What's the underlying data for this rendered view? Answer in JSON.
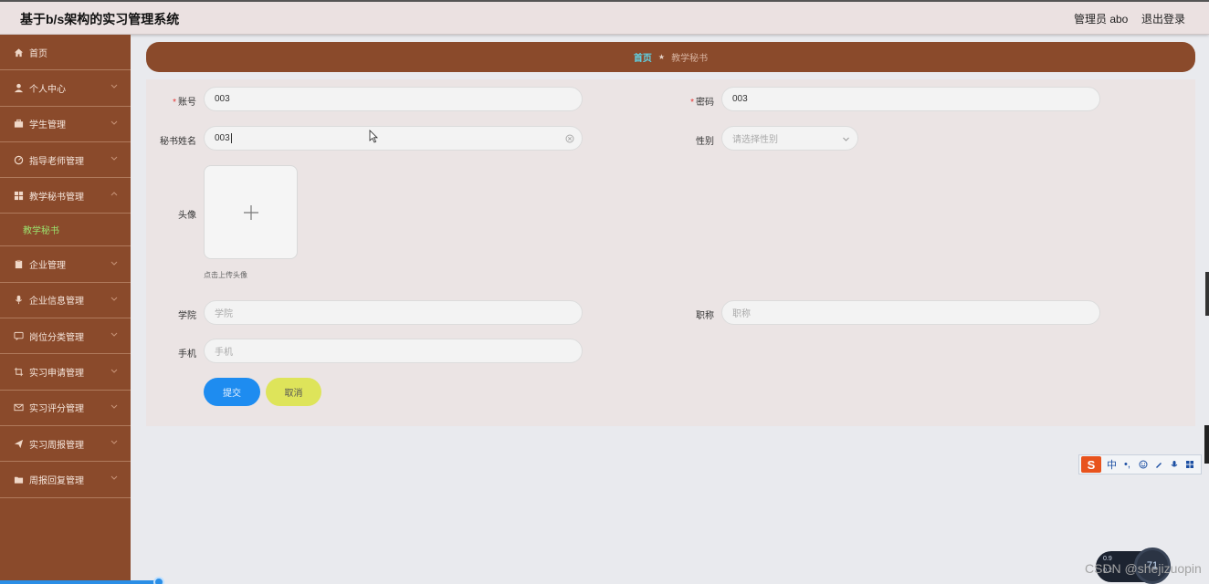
{
  "header": {
    "title": "基于b/s架构的实习管理系统",
    "user": "管理员 abo",
    "logout": "退出登录"
  },
  "sidebar": {
    "items": [
      {
        "label": "首页",
        "icon": "home-icon",
        "expandable": false
      },
      {
        "label": "个人中心",
        "icon": "user-icon",
        "expandable": true
      },
      {
        "label": "学生管理",
        "icon": "briefcase-icon",
        "expandable": true
      },
      {
        "label": "指导老师管理",
        "icon": "dashboard-icon",
        "expandable": true
      },
      {
        "label": "教学秘书管理",
        "icon": "grid-icon",
        "expandable": true,
        "expanded": true,
        "children": [
          {
            "label": "教学秘书",
            "active": true
          }
        ]
      },
      {
        "label": "企业管理",
        "icon": "clipboard-icon",
        "expandable": true
      },
      {
        "label": "企业信息管理",
        "icon": "mic-icon",
        "expandable": true
      },
      {
        "label": "岗位分类管理",
        "icon": "chat-icon",
        "expandable": true
      },
      {
        "label": "实习申请管理",
        "icon": "crop-icon",
        "expandable": true
      },
      {
        "label": "实习评分管理",
        "icon": "mail-icon",
        "expandable": true
      },
      {
        "label": "实习周报管理",
        "icon": "send-icon",
        "expandable": true
      },
      {
        "label": "周报回复管理",
        "icon": "folder-icon",
        "expandable": true
      }
    ]
  },
  "breadcrumb": {
    "home": "首页",
    "separator": "★",
    "current": "教学秘书"
  },
  "form": {
    "account": {
      "label": "账号",
      "value": "003",
      "required": true
    },
    "password": {
      "label": "密码",
      "value": "003",
      "required": true
    },
    "name": {
      "label": "秘书姓名",
      "value": "003"
    },
    "gender": {
      "label": "性别",
      "placeholder": "请选择性别"
    },
    "avatar": {
      "label": "头像",
      "hint": "点击上传头像"
    },
    "college": {
      "label": "学院",
      "placeholder": "学院"
    },
    "title": {
      "label": "职称",
      "placeholder": "职称"
    },
    "phone": {
      "label": "手机",
      "placeholder": "手机"
    },
    "submit": "提交",
    "cancel": "取消"
  },
  "ime": {
    "logo": "S",
    "mode": "中",
    "punct": "•,"
  },
  "watermark": "CSDN @shejizuopin",
  "gauge": {
    "up": "0.9",
    "down": "0.2",
    "value": "71"
  },
  "colors": {
    "brown": "#8a4a2b",
    "submit": "#1e8cf0",
    "cancel": "#dee45a",
    "active_submenu": "#9be36e",
    "breadcrumb_home": "#5fd3e6"
  }
}
